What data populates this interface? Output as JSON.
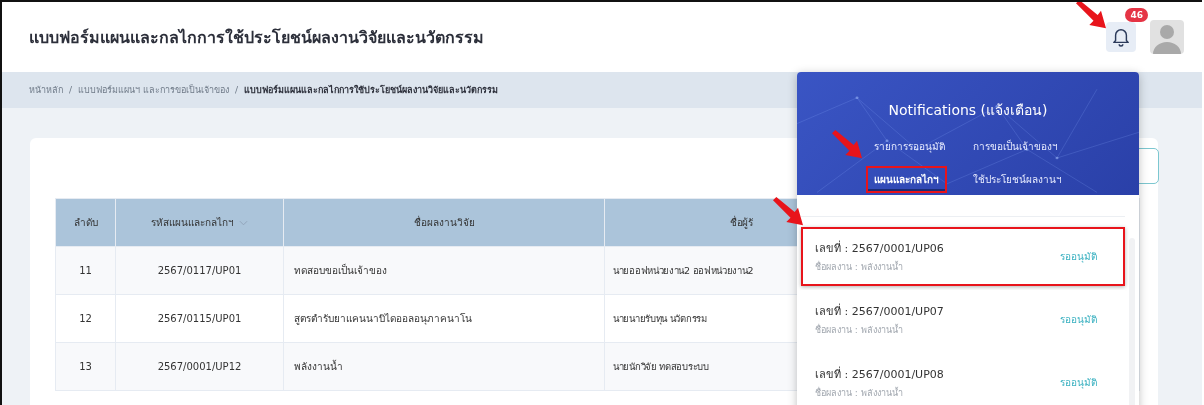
{
  "header": {
    "title": "แบบฟอร์มแผนและกลไกการใช้ประโยชน์ผลงานวิจัยและนวัตกรรม",
    "notification_count": "46",
    "bell_arrow": true
  },
  "breadcrumb_separator": "/",
  "breadcrumb": [
    {
      "label": "หน้าหลัก",
      "current": false
    },
    {
      "label": "แบบฟอร์มแผนฯ และการขอเป็นเจ้าของ",
      "current": false
    },
    {
      "label": "แบบฟอร์มแผนและกลไกการใช้ประโยชน์ผลงานวิจัยและนวัตกรรม",
      "current": true
    }
  ],
  "table": {
    "columns": [
      {
        "label": "ลำดับ",
        "sortable": false
      },
      {
        "label": "รหัสแผนและกลไกฯ",
        "sortable": true
      },
      {
        "label": "ชื่อผลงานวิจัย",
        "sortable": false
      },
      {
        "label": "ชื่อผู้รั",
        "sortable": false
      }
    ],
    "rows": [
      [
        "11",
        "2567/0117/UP01",
        "ทดสอบขอเป็นเจ้าของ",
        "นายออฟหน่วยงาน2 ออฟหน่วยงาน2"
      ],
      [
        "12",
        "2567/0115/UP01",
        "สูตรตำรับยาแคนนาบิไดออลอนุภาคนาโน",
        "นายนายรับทุน นวัตกรรม"
      ],
      [
        "13",
        "2567/0001/UP12",
        "พลังงานน้ำ",
        "นายนักวิจัย ทดสอบระบบ"
      ]
    ]
  },
  "notifications": {
    "title": "Notifications (แจ้งเตือน)",
    "tabs": [
      {
        "label": "รายการรออนุมัติ",
        "selected": false,
        "highlighted": false,
        "arrow": false
      },
      {
        "label": "การขอเป็นเจ้าของฯ",
        "selected": false,
        "highlighted": false,
        "arrow": false
      },
      {
        "label": "แผนและกลไกฯ",
        "selected": true,
        "highlighted": true,
        "arrow": true
      },
      {
        "label": "ใช้ประโยชน์ผลงานฯ",
        "selected": false,
        "highlighted": false,
        "arrow": false
      }
    ],
    "items": [
      {
        "number": "เลขที่ : 2567/0001/UP06",
        "work": "ชื่อผลงาน : พลังงานน้ำ",
        "status": "รออนุมัติ",
        "highlighted": true,
        "arrow": true
      },
      {
        "number": "เลขที่ : 2567/0001/UP07",
        "work": "ชื่อผลงาน : พลังงานน้ำ",
        "status": "รออนุมัติ",
        "highlighted": false,
        "arrow": false
      },
      {
        "number": "เลขที่ : 2567/0001/UP08",
        "work": "ชื่อผลงาน : พลังงานน้ำ",
        "status": "รออนุมัติ",
        "highlighted": false,
        "arrow": false
      }
    ]
  }
}
